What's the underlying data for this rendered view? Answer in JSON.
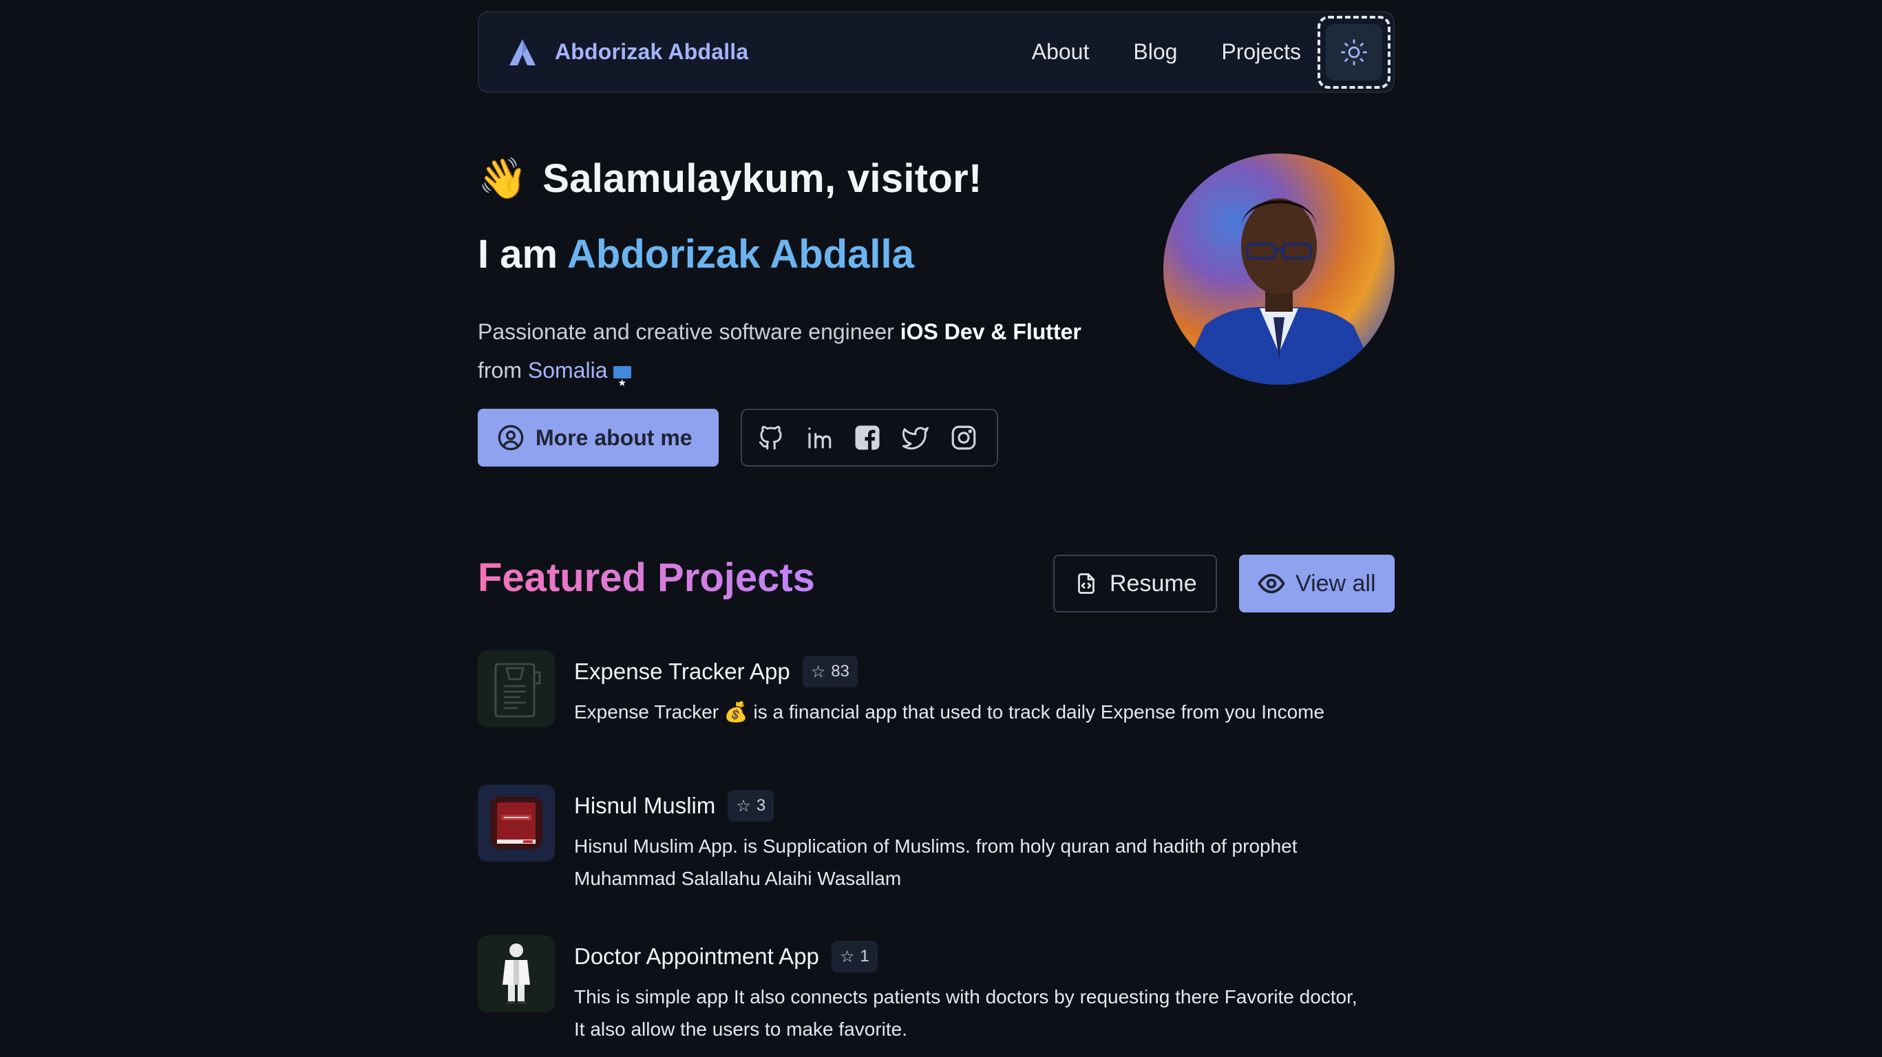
{
  "nav": {
    "brand": "Abdorizak Abdalla",
    "links": [
      "About",
      "Blog",
      "Projects"
    ]
  },
  "hero": {
    "wave": "👋",
    "greeting": "Salamulaykum, visitor!",
    "iam_prefix": "I am ",
    "name": "Abdorizak Abdalla",
    "bio_1": "Passionate and creative software engineer ",
    "bio_bold_1": "iOS Dev & Flutter",
    "bio_2": " from ",
    "country": "Somalia",
    "more_button": "More about me",
    "socials": [
      "github-icon",
      "linkedin-icon",
      "facebook-icon",
      "twitter-icon",
      "instagram-icon"
    ]
  },
  "featured": {
    "title": "Featured Projects",
    "resume_button": "Resume",
    "view_all_button": "View all",
    "projects": [
      {
        "name": "Expense Tracker App",
        "stars": "83",
        "description": "Expense Tracker 💰 is a financial app that used to track daily Expense from you Income",
        "thumb_color": "#16201d"
      },
      {
        "name": "Hisnul Muslim",
        "stars": "3",
        "description": "Hisnul Muslim App. is Supplication of Muslims. from holy quran and hadith of prophet Muhammad Salallahu Alaihi Wasallam",
        "thumb_color": "#1b2440"
      },
      {
        "name": "Doctor Appointment App",
        "stars": "1",
        "description": "This is simple app It also connects patients with doctors by requesting there Favorite doctor, It also allow the users to make favorite.",
        "thumb_color": "#16201d"
      }
    ]
  },
  "colors": {
    "background": "#0d1117",
    "accent": "#8fa2f0",
    "name_blue": "#6cb4f0",
    "title_gradient_start": "#f472b6",
    "title_gradient_end": "#c084fc"
  }
}
